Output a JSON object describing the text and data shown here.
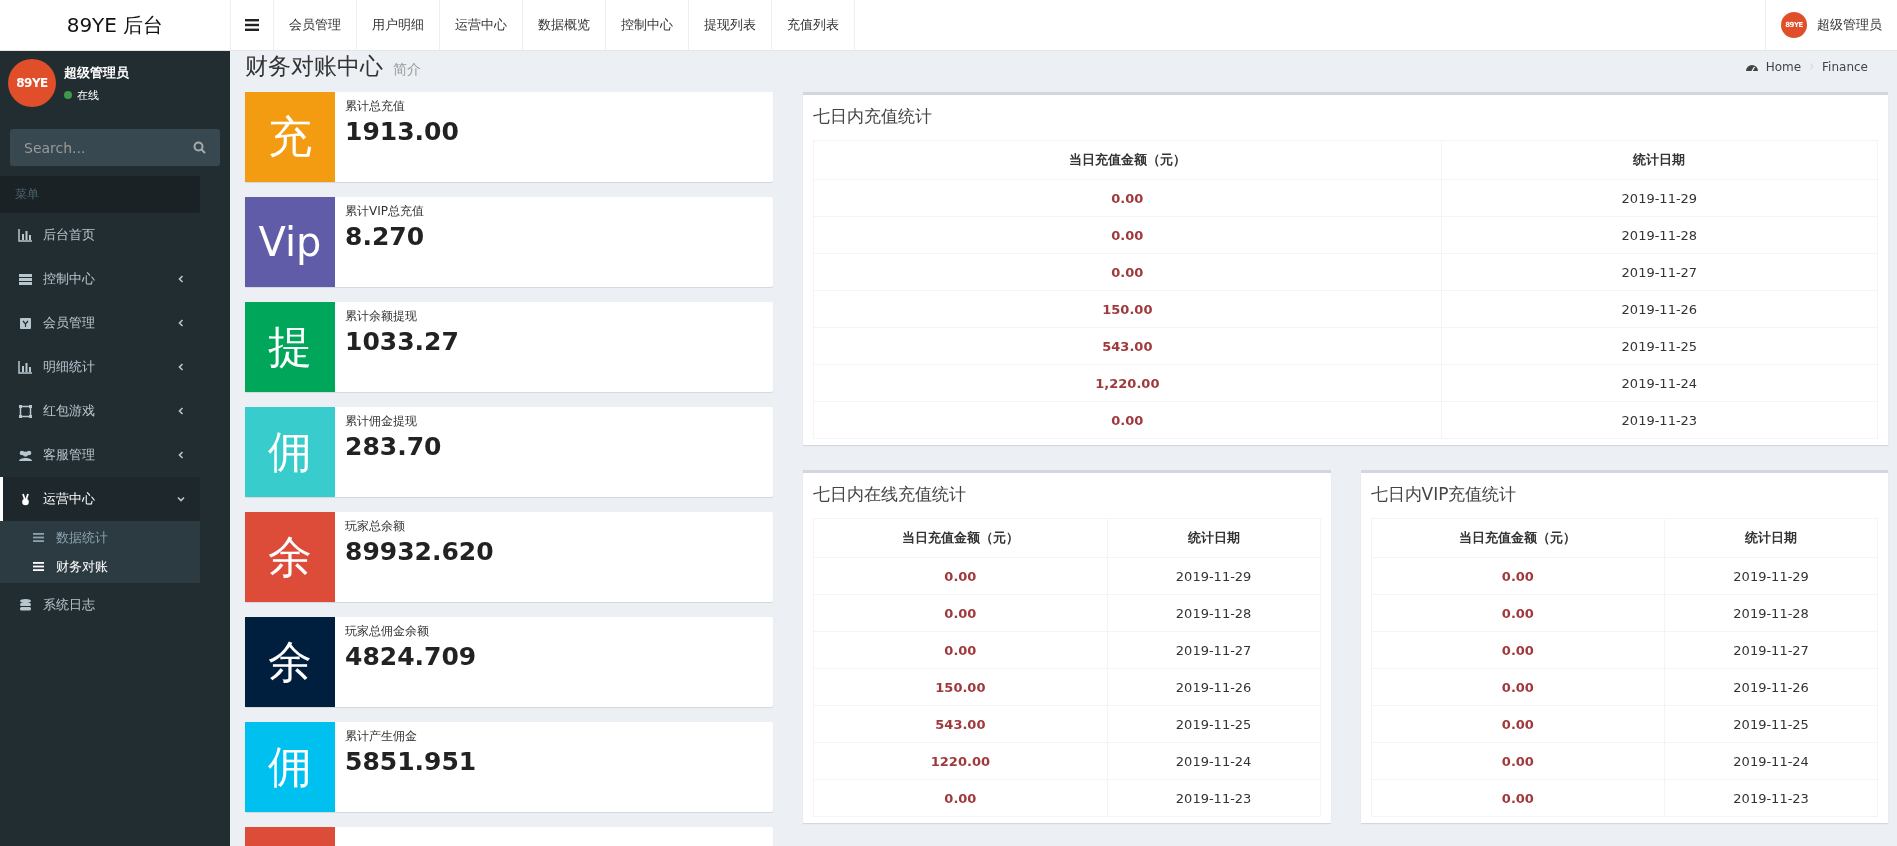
{
  "topbar": {
    "brand": "89YE 后台",
    "nav": [
      "会员管理",
      "用户明细",
      "运营中心",
      "数据概览",
      "控制中心",
      "提现列表",
      "充值列表"
    ],
    "user": {
      "avatar": "89YE",
      "name": "超级管理员"
    }
  },
  "sidebar": {
    "user": {
      "avatar": "89YE",
      "name": "超级管理员",
      "status": "在线"
    },
    "search": {
      "placeholder": "Search..."
    },
    "header": "菜单",
    "items": [
      {
        "label": "后台首页",
        "selected": false
      },
      {
        "label": "控制中心",
        "selected": false,
        "expanded": false
      },
      {
        "label": "会员管理",
        "selected": false,
        "expanded": false
      },
      {
        "label": "明细统计",
        "selected": false,
        "expanded": false
      },
      {
        "label": "红包游戏",
        "selected": false,
        "expanded": false
      },
      {
        "label": "客服管理",
        "selected": false,
        "expanded": false
      },
      {
        "label": "运营中心",
        "selected": true,
        "expanded": true,
        "children": [
          {
            "label": "数据统计",
            "selected": false
          },
          {
            "label": "财务对账",
            "selected": true
          }
        ]
      },
      {
        "label": "系统日志",
        "selected": false
      }
    ]
  },
  "page": {
    "title": "财务对账中心",
    "subtitle": "简介",
    "breadcrumb": [
      "Home",
      "Finance"
    ]
  },
  "stats": [
    {
      "glyph": "充",
      "label": "累计总充值",
      "value": "1913.00",
      "color": "#f39c12"
    },
    {
      "glyph": "Vip",
      "label": "累计VIP总充值",
      "value": "8.270",
      "color": "#605ca8"
    },
    {
      "glyph": "提",
      "label": "累计余额提现",
      "value": "1033.27",
      "color": "#00a65a"
    },
    {
      "glyph": "佣",
      "label": "累计佣金提现",
      "value": "283.70",
      "color": "#39cccc"
    },
    {
      "glyph": "余",
      "label": "玩家总余额",
      "value": "89932.620",
      "color": "#dd4b39"
    },
    {
      "glyph": "余",
      "label": "玩家总佣金余额",
      "value": "4824.709",
      "color": "#001f3f"
    },
    {
      "glyph": "佣",
      "label": "累计产生佣金",
      "value": "5851.951",
      "color": "#00c0ef"
    },
    {
      "color": "#dd4b39"
    }
  ],
  "panels": [
    {
      "title": "七日内充值统计",
      "columns": [
        "当日充值金额（元）",
        "统计日期"
      ],
      "rows": [
        {
          "amount": "0.00",
          "date": "2019-11-29"
        },
        {
          "amount": "0.00",
          "date": "2019-11-28"
        },
        {
          "amount": "0.00",
          "date": "2019-11-27"
        },
        {
          "amount": "150.00",
          "date": "2019-11-26"
        },
        {
          "amount": "543.00",
          "date": "2019-11-25"
        },
        {
          "amount": "1,220.00",
          "date": "2019-11-24"
        },
        {
          "amount": "0.00",
          "date": "2019-11-23"
        }
      ]
    },
    {
      "title": "七日内在线充值统计",
      "columns": [
        "当日充值金额（元）",
        "统计日期"
      ],
      "rows": [
        {
          "amount": "0.00",
          "date": "2019-11-29"
        },
        {
          "amount": "0.00",
          "date": "2019-11-28"
        },
        {
          "amount": "0.00",
          "date": "2019-11-27"
        },
        {
          "amount": "150.00",
          "date": "2019-11-26"
        },
        {
          "amount": "543.00",
          "date": "2019-11-25"
        },
        {
          "amount": "1220.00",
          "date": "2019-11-24"
        },
        {
          "amount": "0.00",
          "date": "2019-11-23"
        }
      ]
    },
    {
      "title": "七日内VIP充值统计",
      "columns": [
        "当日充值金额（元）",
        "统计日期"
      ],
      "rows": [
        {
          "amount": "0.00",
          "date": "2019-11-29"
        },
        {
          "amount": "0.00",
          "date": "2019-11-28"
        },
        {
          "amount": "0.00",
          "date": "2019-11-27"
        },
        {
          "amount": "0.00",
          "date": "2019-11-26"
        },
        {
          "amount": "0.00",
          "date": "2019-11-25"
        },
        {
          "amount": "0.00",
          "date": "2019-11-24"
        },
        {
          "amount": "0.00",
          "date": "2019-11-23"
        }
      ]
    }
  ]
}
